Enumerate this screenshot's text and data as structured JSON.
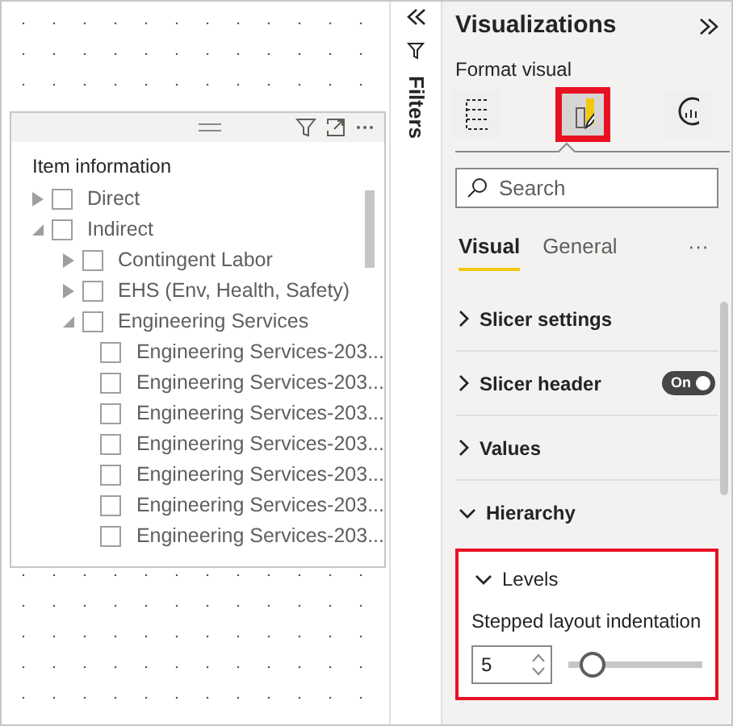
{
  "slicer": {
    "title": "Item information",
    "tree": [
      {
        "label": "Direct",
        "expanded": false,
        "checked": false
      },
      {
        "label": "Indirect",
        "expanded": true,
        "checked": false,
        "children": [
          {
            "label": "Contingent Labor",
            "expanded": false,
            "checked": false
          },
          {
            "label": "EHS (Env, Health, Safety)",
            "expanded": false,
            "checked": false
          },
          {
            "label": "Engineering Services",
            "expanded": true,
            "checked": false,
            "children": [
              {
                "label": "Engineering Services-203...",
                "checked": false
              },
              {
                "label": "Engineering Services-203...",
                "checked": false
              },
              {
                "label": "Engineering Services-203...",
                "checked": false
              },
              {
                "label": "Engineering Services-203...",
                "checked": false
              },
              {
                "label": "Engineering Services-203...",
                "checked": false
              },
              {
                "label": "Engineering Services-203...",
                "checked": false
              },
              {
                "label": "Engineering Services-203...",
                "checked": false
              }
            ]
          }
        ]
      }
    ]
  },
  "filters": {
    "label": "Filters"
  },
  "pane": {
    "title": "Visualizations",
    "subtitle": "Format visual",
    "icon_tabs": [
      {
        "kind": "fields",
        "selected": false
      },
      {
        "kind": "format",
        "selected": true
      },
      {
        "kind": "analytics",
        "selected": false
      }
    ],
    "search": {
      "placeholder": "Search"
    },
    "tabs": [
      {
        "label": "Visual",
        "selected": true
      },
      {
        "label": "General",
        "selected": false
      }
    ],
    "more": "···",
    "sections": [
      {
        "label": "Slicer settings",
        "expanded": false
      },
      {
        "label": "Slicer header",
        "expanded": false,
        "toggle": {
          "label": "On",
          "on": true
        }
      },
      {
        "label": "Values",
        "expanded": false
      },
      {
        "label": "Hierarchy",
        "expanded": true,
        "card": {
          "label": "Levels",
          "expanded": true,
          "field_label": "Stepped layout indentation",
          "value": "5",
          "level": 0.08
        }
      }
    ]
  }
}
